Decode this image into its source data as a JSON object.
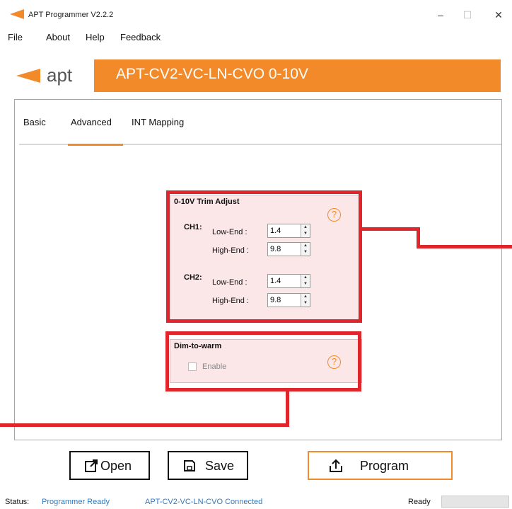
{
  "window": {
    "title": "APT Programmer V2.2.2",
    "minimize": "–",
    "maximize": "☐",
    "close": "✕"
  },
  "menu": [
    "File",
    "About",
    "Help",
    "Feedback"
  ],
  "banner": {
    "brand": "apt",
    "model": "APT-CV2-VC-LN-CVO 0-10V"
  },
  "tabs": [
    "Basic",
    "Advanced",
    "INT Mapping"
  ],
  "active_tab": "Advanced",
  "trim": {
    "title": "0-10V Trim Adjust",
    "help": "?",
    "ch1": {
      "label": "CH1:",
      "low_label": "Low-End :",
      "low": "1.4",
      "high_label": "High-End :",
      "high": "9.8"
    },
    "ch2": {
      "label": "CH2:",
      "low_label": "Low-End :",
      "low": "1.4",
      "high_label": "High-End :",
      "high": "9.8"
    }
  },
  "dtw": {
    "title": "Dim-to-warm",
    "enable": "Enable",
    "help": "?"
  },
  "buttons": {
    "open": "Open",
    "save": "Save",
    "program": "Program"
  },
  "status": {
    "label": "Status:",
    "value": "Programmer Ready",
    "device": "APT-CV2-VC-LN-CVO Connected",
    "ready": "Ready"
  },
  "colors": {
    "accent": "#f28a2a",
    "highlight": "#e0262d",
    "status_text": "#2f7bbf"
  }
}
